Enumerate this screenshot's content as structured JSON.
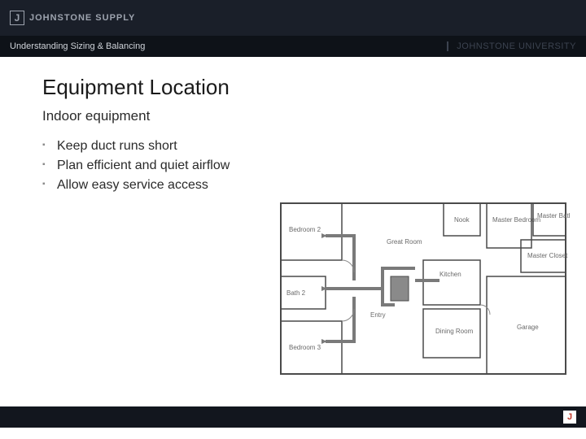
{
  "header": {
    "logo_mark": "J",
    "logo_text": "JOHNSTONE SUPPLY"
  },
  "subheader": {
    "left": "Understanding Sizing & Balancing",
    "right": "JOHNSTONE UNIVERSITY"
  },
  "main": {
    "title": "Equipment Location",
    "subtitle": "Indoor equipment",
    "bullets": [
      "Keep duct runs short",
      "Plan efficient and quiet airflow",
      "Allow easy service access"
    ]
  },
  "floorplan": {
    "rooms": {
      "bedroom2": "Bedroom 2",
      "bath2": "Bath 2",
      "bedroom3": "Bedroom 3",
      "entry": "Entry",
      "great_room": "Great Room",
      "kitchen": "Kitchen",
      "dining": "Dining Room",
      "nook": "Nook",
      "master_bedroom": "Master Bedroom",
      "master_bath": "Master Bath",
      "master_closet": "Master Closet",
      "garage": "Garage"
    }
  },
  "footer": {
    "logo": "J"
  }
}
